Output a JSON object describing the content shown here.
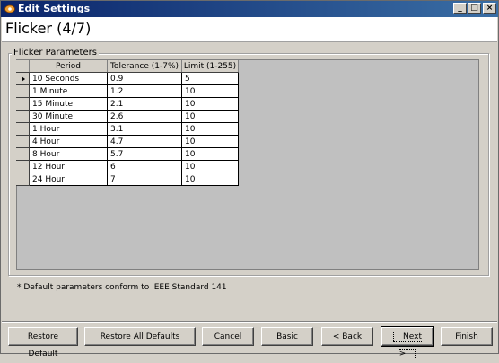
{
  "window": {
    "title": "Edit Settings",
    "min_label": "_",
    "max_label": "□",
    "close_label": "×"
  },
  "header": {
    "title": "Flicker (4/7)"
  },
  "group": {
    "label": "Flicker Parameters"
  },
  "table": {
    "columns": [
      "Period",
      "Tolerance (1-7%)",
      "Limit (1-255)"
    ],
    "rows": [
      {
        "period": "10 Seconds",
        "tolerance": "0.9",
        "limit": "5",
        "selected": true
      },
      {
        "period": "1 Minute",
        "tolerance": "1.2",
        "limit": "10"
      },
      {
        "period": "15 Minute",
        "tolerance": "2.1",
        "limit": "10"
      },
      {
        "period": "30 Minute",
        "tolerance": "2.6",
        "limit": "10"
      },
      {
        "period": "1 Hour",
        "tolerance": "3.1",
        "limit": "10"
      },
      {
        "period": "4 Hour",
        "tolerance": "4.7",
        "limit": "10"
      },
      {
        "period": "8 Hour",
        "tolerance": "5.7",
        "limit": "10"
      },
      {
        "period": "12 Hour",
        "tolerance": "6",
        "limit": "10"
      },
      {
        "period": "24 Hour",
        "tolerance": "7",
        "limit": "10"
      }
    ]
  },
  "footnote": "* Default parameters conform to IEEE Standard 141",
  "buttons": {
    "restore_default": "Restore Default",
    "restore_all_defaults": "Restore All Defaults",
    "cancel": "Cancel",
    "basic": "Basic",
    "back": "< Back",
    "next": "Next >",
    "finish": "Finish"
  },
  "colors": {
    "titlebar_start": "#0a246a",
    "titlebar_end": "#3a6ea5",
    "face": "#d4d0c8"
  }
}
